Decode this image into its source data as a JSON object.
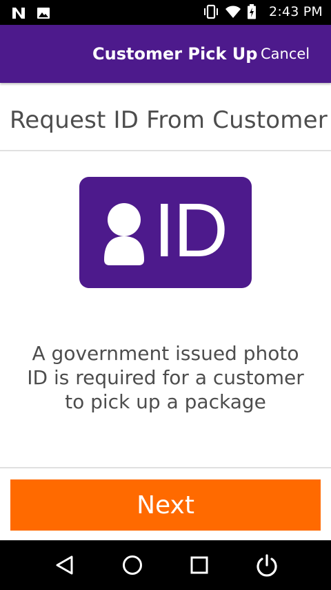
{
  "status_bar": {
    "time": "2:43 PM",
    "left_icons": [
      "n-notification-icon",
      "image-notification-icon"
    ],
    "right_icons": [
      "vibrate-icon",
      "wifi-icon",
      "battery-charging-icon"
    ]
  },
  "app_bar": {
    "title": "Customer Pick Up",
    "cancel_label": "Cancel",
    "background": "#4d1a8c"
  },
  "main": {
    "heading": "Request ID From Customer",
    "id_icon": {
      "name": "person-id-icon",
      "text": "ID",
      "color": "#4d1a8c"
    },
    "description_lines": [
      "A government issued photo",
      "ID is required for a customer",
      "to pick up a package"
    ]
  },
  "footer": {
    "next_label": "Next",
    "next_color": "#ff6a00"
  },
  "nav_bar": {
    "buttons": [
      "back-icon",
      "home-icon",
      "recents-icon",
      "power-icon"
    ]
  }
}
